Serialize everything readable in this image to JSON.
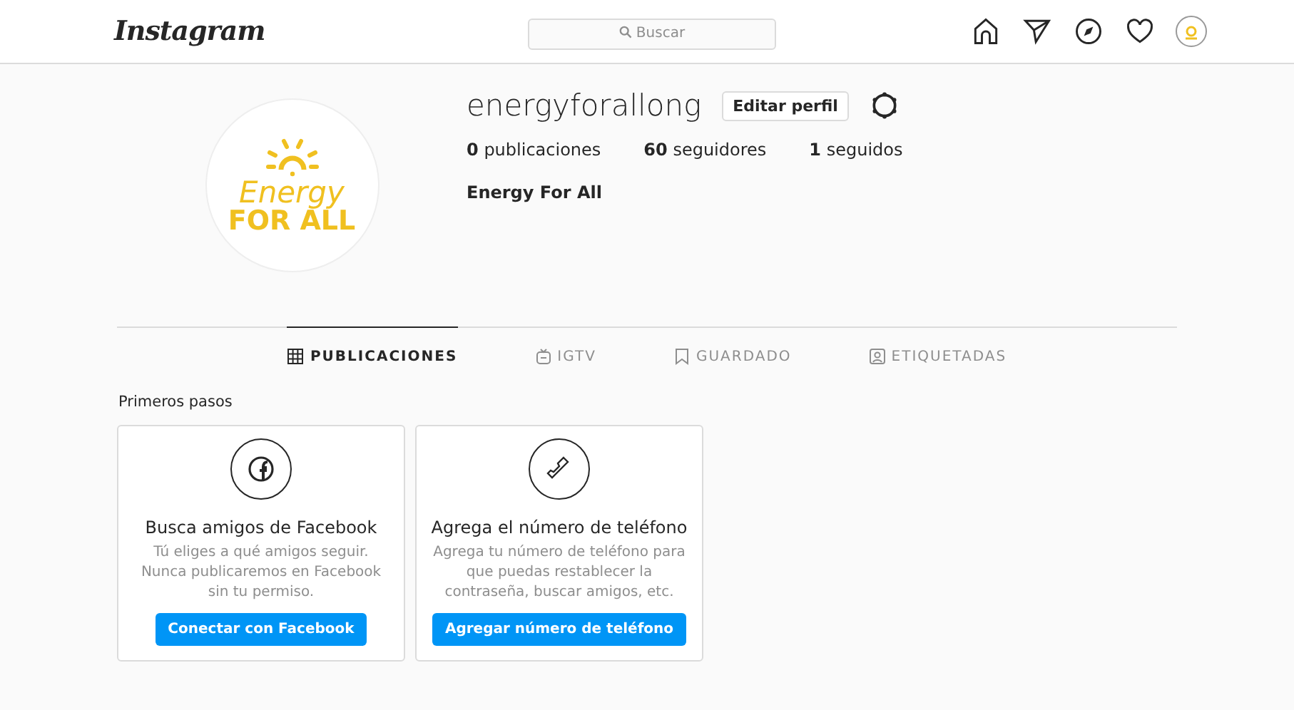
{
  "header": {
    "logo": "Instagram",
    "search": {
      "placeholder": "Buscar"
    }
  },
  "profile": {
    "avatar": {
      "line1": "Energy",
      "line2": "FOR ALL"
    },
    "username": "energyforallong",
    "edit_button": "Editar perfil",
    "stats": [
      {
        "count": "0",
        "label": "publicaciones"
      },
      {
        "count": "60",
        "label": "seguidores"
      },
      {
        "count": "1",
        "label": "seguidos"
      }
    ],
    "full_name": "Energy For All"
  },
  "tabs": [
    {
      "kind": "grid",
      "label": "PUBLICACIONES",
      "selected": true
    },
    {
      "kind": "tv",
      "label": "IGTV",
      "selected": false
    },
    {
      "kind": "bookmark",
      "label": "GUARDADO",
      "selected": false
    },
    {
      "kind": "tag",
      "label": "ETIQUETADAS",
      "selected": false
    }
  ],
  "getting_started": {
    "title": "Primeros pasos",
    "cards": [
      {
        "kind": "facebook",
        "title": "Busca amigos de Facebook",
        "text": "Tú eliges a qué amigos seguir. Nunca publicaremos en Facebook sin tu permiso.",
        "button": "Conectar con Facebook"
      },
      {
        "kind": "phone",
        "title": "Agrega el número de teléfono",
        "text": "Agrega tu número de teléfono para que puedas restablecer la contraseña, buscar amigos, etc.",
        "button": "Agregar número de teléfono"
      }
    ]
  }
}
